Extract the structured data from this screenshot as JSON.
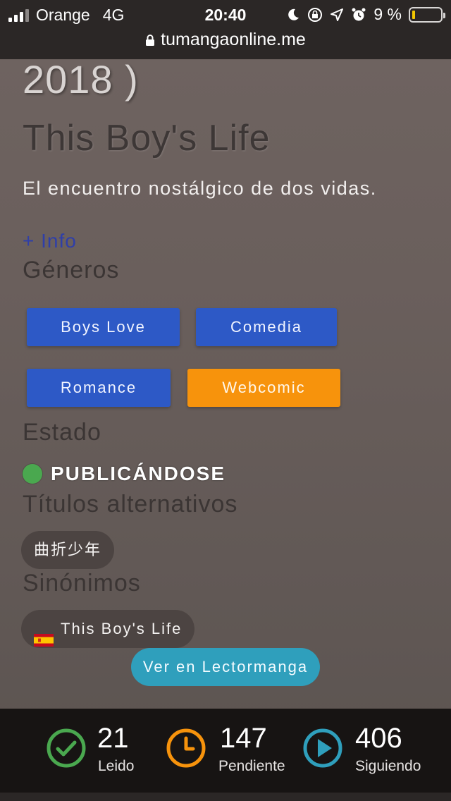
{
  "status_bar": {
    "carrier": "Orange",
    "network": "4G",
    "time": "20:40",
    "battery": "9 %",
    "battery_level": 0.09
  },
  "browser": {
    "url": "tumangaonline.me"
  },
  "header": {
    "year": "2018 )",
    "title": "This Boy's Life",
    "subtitle": "El encuentro nostálgico de dos vidas."
  },
  "info_link": "+ Info",
  "genres": {
    "heading": "Géneros",
    "items": [
      {
        "label": "Boys Love",
        "color": "#2d59c6"
      },
      {
        "label": "Comedia",
        "color": "#2d59c6"
      },
      {
        "label": "Romance",
        "color": "#2d59c6"
      },
      {
        "label": "Webcomic",
        "color": "#f7930c"
      }
    ]
  },
  "estado": {
    "heading": "Estado",
    "value": "PUBLICÁNDOSE",
    "color": "#4aa84f"
  },
  "alt_titles": {
    "heading": "Títulos alternativos",
    "items": [
      "曲折少年"
    ]
  },
  "synonyms": {
    "heading": "Sinónimos",
    "items": [
      {
        "flag": "spain-flag",
        "label": "This Boy's Life"
      }
    ]
  },
  "cta": {
    "label": "Ver en Lectormanga"
  },
  "stats": [
    {
      "icon": "check-circle-icon",
      "count": "21",
      "label": "Leido",
      "color": "#4aa84f"
    },
    {
      "icon": "clock-icon",
      "count": "147",
      "label": "Pendiente",
      "color": "#f7930c"
    },
    {
      "icon": "play-circle-icon",
      "count": "406",
      "label": "Siguiendo",
      "color": "#2f9fbc"
    }
  ]
}
